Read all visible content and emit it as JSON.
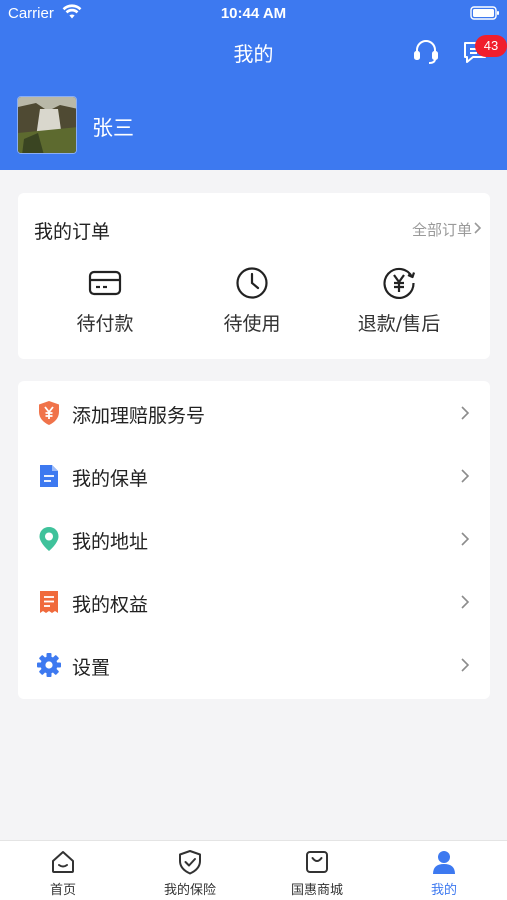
{
  "status_bar": {
    "carrier": "Carrier",
    "time": "10:44 AM"
  },
  "header": {
    "title": "我的",
    "message_badge": "43"
  },
  "profile": {
    "name": "张三"
  },
  "orders": {
    "title": "我的订单",
    "all_label": "全部订单",
    "items": [
      {
        "label": "待付款",
        "icon": "card-icon"
      },
      {
        "label": "待使用",
        "icon": "clock-icon"
      },
      {
        "label": "退款/售后",
        "icon": "refund-icon"
      }
    ]
  },
  "menu": [
    {
      "label": "添加理赔服务号",
      "icon": "shield-yen-icon"
    },
    {
      "label": "我的保单",
      "icon": "document-icon"
    },
    {
      "label": "我的地址",
      "icon": "location-pin-icon"
    },
    {
      "label": "我的权益",
      "icon": "receipt-icon"
    },
    {
      "label": "设置",
      "icon": "gear-icon"
    }
  ],
  "tabs": [
    {
      "label": "首页",
      "icon": "home-icon"
    },
    {
      "label": "我的保险",
      "icon": "shield-check-icon"
    },
    {
      "label": "国惠商城",
      "icon": "shopping-bag-icon"
    },
    {
      "label": "我的",
      "icon": "person-icon",
      "active": true
    }
  ],
  "colors": {
    "brand": "#3d79f0",
    "badge": "#f01e2c"
  }
}
